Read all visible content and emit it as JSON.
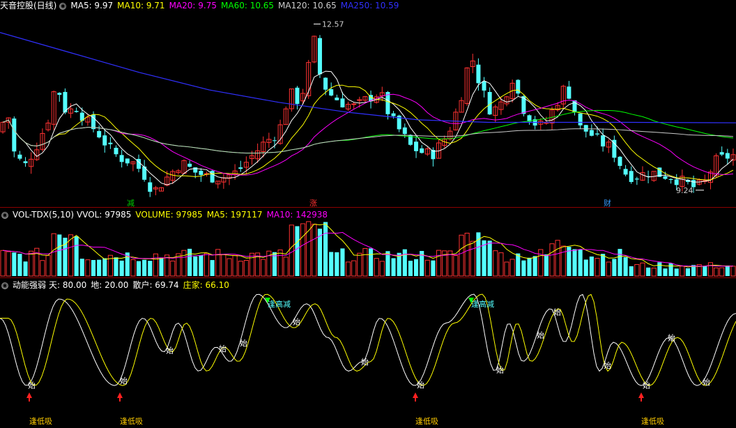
{
  "price_panel": {
    "title": "天音控股(日线)",
    "ma": [
      {
        "label": "MA5: 9.97",
        "color": "#ffffff"
      },
      {
        "label": "MA10: 9.71",
        "color": "#ffff00"
      },
      {
        "label": "MA20: 9.75",
        "color": "#ff00ff"
      },
      {
        "label": "MA60: 10.65",
        "color": "#00ff00"
      },
      {
        "label": "MA120: 10.65",
        "color": "#cccccc"
      },
      {
        "label": "MA250: 10.59",
        "color": "#3030ff"
      }
    ],
    "high_label": "12.57",
    "low_label": "9.24",
    "markers": [
      {
        "text": "减",
        "color": "#00cc00"
      },
      {
        "text": "涨",
        "color": "#ff3030"
      },
      {
        "text": "财",
        "color": "#3399ff"
      }
    ]
  },
  "volume_panel": {
    "title": "VOL-TDX(5,10)",
    "vvol": "VVOL: 97985",
    "volume": "VOLUME: 97985",
    "ma5": "MA5: 197117",
    "ma10": "MA10: 142938"
  },
  "indicator_panel": {
    "title": "动能强弱",
    "tian": "天: 80.00",
    "di": "地: 20.00",
    "sanhu": "散户: 69.74",
    "zhuangjia": "庄家: 66.10",
    "high_signal": "逢高减",
    "low_signal": "逢低吸",
    "start_mark": "始"
  },
  "colors": {
    "up": "#ff3232",
    "down": "#54ffff",
    "sep": "#8b0000"
  },
  "chart_data": {
    "type": "candlestick",
    "low_value": 9.24,
    "high_value": 12.57,
    "ylim": [
      9.0,
      12.8
    ]
  }
}
